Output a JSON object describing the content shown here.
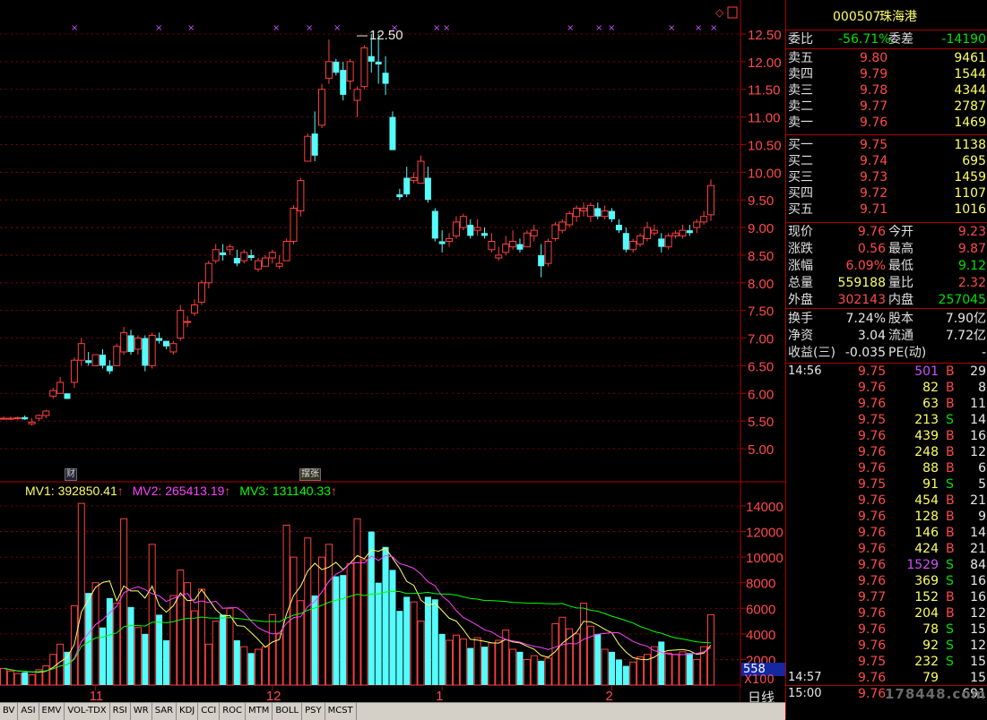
{
  "stock": {
    "code": "000507",
    "name": "珠海港"
  },
  "price_axis": [
    "12.50",
    "12.00",
    "11.50",
    "11.00",
    "10.50",
    "10.00",
    "9.50",
    "9.00",
    "8.50",
    "8.00",
    "7.50",
    "7.00",
    "6.50",
    "6.00",
    "5.50",
    "5.00"
  ],
  "volume_axis": [
    "14000",
    "12000",
    "10000",
    "8000",
    "6000",
    "4000",
    "2000"
  ],
  "volume_unit": "X100",
  "current_volume_badge": "558",
  "period_label": "日线",
  "nav_buttons": [
    "+",
    "-",
    "□"
  ],
  "month_labels": [
    "11",
    "12",
    "1",
    "2"
  ],
  "high_marker": "12.50",
  "event_tags": [
    "财",
    "摆张"
  ],
  "mv": {
    "mv1_label": "MV1: 392850.41",
    "mv2_label": "MV2: 265413.19",
    "mv3_label": "MV3: 131140.33",
    "colors": {
      "mv1": "#ffff66",
      "mv2": "#ff40ff",
      "mv3": "#00ff00"
    }
  },
  "indicator_tabs": [
    "BV",
    "ASI",
    "EMV",
    "VOL-TDX",
    "RSI",
    "WR",
    "SAR",
    "KDJ",
    "CCI",
    "ROC",
    "MTM",
    "BOLL",
    "PSY",
    "MCST"
  ],
  "quote": {
    "weibi": {
      "label": "委比",
      "value": "-56.71%",
      "label2": "委差",
      "value2": "-14190"
    },
    "sells": [
      {
        "label": "卖五",
        "price": "9.80",
        "vol": "9461"
      },
      {
        "label": "卖四",
        "price": "9.79",
        "vol": "1544"
      },
      {
        "label": "卖三",
        "price": "9.78",
        "vol": "4344"
      },
      {
        "label": "卖二",
        "price": "9.77",
        "vol": "2787"
      },
      {
        "label": "卖一",
        "price": "9.76",
        "vol": "1469"
      }
    ],
    "buys": [
      {
        "label": "买一",
        "price": "9.75",
        "vol": "1138"
      },
      {
        "label": "买二",
        "price": "9.74",
        "vol": "695"
      },
      {
        "label": "买三",
        "price": "9.73",
        "vol": "1459"
      },
      {
        "label": "买四",
        "price": "9.72",
        "vol": "1107"
      },
      {
        "label": "买五",
        "price": "9.71",
        "vol": "1016"
      }
    ],
    "stats": [
      {
        "l1": "现价",
        "v1": "9.76",
        "l2": "今开",
        "v2": "9.23",
        "c1": "red",
        "c2": "red"
      },
      {
        "l1": "涨跌",
        "v1": "0.56",
        "l2": "最高",
        "v2": "9.87",
        "c1": "red",
        "c2": "red"
      },
      {
        "l1": "涨幅",
        "v1": "6.09%",
        "l2": "最低",
        "v2": "9.12",
        "c1": "red",
        "c2": "green"
      },
      {
        "l1": "总量",
        "v1": "559188",
        "l2": "量比",
        "v2": "2.32",
        "c1": "yellow",
        "c2": "red"
      },
      {
        "l1": "外盘",
        "v1": "302143",
        "l2": "内盘",
        "v2": "257045",
        "c1": "red",
        "c2": "green"
      }
    ],
    "fundamentals": [
      {
        "l1": "换手",
        "v1": "7.24%",
        "l2": "股本",
        "v2": "7.90亿"
      },
      {
        "l1": "净资",
        "v1": "3.04",
        "l2": "流通",
        "v2": "7.72亿"
      },
      {
        "l1": "收益(三)",
        "v1": "-0.035",
        "l2": "PE(动)",
        "v2": "-"
      }
    ]
  },
  "ticks": [
    {
      "time": "14:56",
      "price": "9.75",
      "vol": "501",
      "bs": "B",
      "n": "29",
      "vc": "purple"
    },
    {
      "time": "",
      "price": "9.76",
      "vol": "82",
      "bs": "B",
      "n": "8",
      "vc": "yellow"
    },
    {
      "time": "",
      "price": "9.76",
      "vol": "63",
      "bs": "B",
      "n": "11",
      "vc": "yellow"
    },
    {
      "time": "",
      "price": "9.75",
      "vol": "213",
      "bs": "S",
      "n": "14",
      "vc": "yellow"
    },
    {
      "time": "",
      "price": "9.76",
      "vol": "439",
      "bs": "B",
      "n": "16",
      "vc": "yellow"
    },
    {
      "time": "",
      "price": "9.76",
      "vol": "248",
      "bs": "B",
      "n": "12",
      "vc": "yellow"
    },
    {
      "time": "",
      "price": "9.76",
      "vol": "88",
      "bs": "B",
      "n": "6",
      "vc": "yellow"
    },
    {
      "time": "",
      "price": "9.75",
      "vol": "91",
      "bs": "S",
      "n": "5",
      "vc": "yellow"
    },
    {
      "time": "",
      "price": "9.76",
      "vol": "454",
      "bs": "B",
      "n": "21",
      "vc": "yellow"
    },
    {
      "time": "",
      "price": "9.76",
      "vol": "128",
      "bs": "B",
      "n": "9",
      "vc": "yellow"
    },
    {
      "time": "",
      "price": "9.76",
      "vol": "146",
      "bs": "B",
      "n": "14",
      "vc": "yellow"
    },
    {
      "time": "",
      "price": "9.76",
      "vol": "424",
      "bs": "B",
      "n": "21",
      "vc": "yellow"
    },
    {
      "time": "",
      "price": "9.76",
      "vol": "1529",
      "bs": "S",
      "n": "84",
      "vc": "purple"
    },
    {
      "time": "",
      "price": "9.76",
      "vol": "369",
      "bs": "S",
      "n": "16",
      "vc": "yellow"
    },
    {
      "time": "",
      "price": "9.77",
      "vol": "152",
      "bs": "B",
      "n": "16",
      "vc": "yellow"
    },
    {
      "time": "",
      "price": "9.76",
      "vol": "204",
      "bs": "B",
      "n": "12",
      "vc": "yellow"
    },
    {
      "time": "",
      "price": "9.76",
      "vol": "78",
      "bs": "S",
      "n": "15",
      "vc": "yellow"
    },
    {
      "time": "",
      "price": "9.76",
      "vol": "92",
      "bs": "S",
      "n": "12",
      "vc": "yellow"
    },
    {
      "time": "",
      "price": "9.75",
      "vol": "232",
      "bs": "S",
      "n": "15",
      "vc": "yellow"
    },
    {
      "time": "14:57",
      "price": "9.76",
      "vol": "79",
      "bs": "",
      "n": "15",
      "vc": "yellow"
    },
    {
      "time": "15:00",
      "price": "9.76",
      "vol": "",
      "bs": "",
      "n": "691",
      "vc": "yellow"
    }
  ],
  "watermark": "178448.com",
  "chart_data": {
    "type": "candlestick",
    "price_ylim": [
      4.6,
      12.8
    ],
    "volume_ylim": [
      0,
      15000
    ],
    "candles": [
      [
        5.55,
        5.58,
        5.52,
        5.55
      ],
      [
        5.55,
        5.58,
        5.52,
        5.55
      ],
      [
        5.55,
        5.58,
        5.52,
        5.56
      ],
      [
        5.57,
        5.6,
        5.52,
        5.53
      ],
      [
        5.45,
        5.55,
        5.42,
        5.48
      ],
      [
        5.55,
        5.62,
        5.5,
        5.6
      ],
      [
        5.6,
        5.7,
        5.55,
        5.68
      ],
      [
        5.95,
        6.1,
        5.9,
        6.05
      ],
      [
        6.0,
        6.3,
        6.0,
        6.2
      ],
      [
        6.0,
        6.0,
        5.9,
        5.9
      ],
      [
        6.2,
        6.65,
        6.1,
        6.6
      ],
      [
        6.6,
        7.0,
        6.5,
        6.9
      ],
      [
        6.6,
        6.75,
        6.5,
        6.55
      ],
      [
        6.5,
        6.7,
        6.5,
        6.7
      ],
      [
        6.7,
        6.8,
        6.45,
        6.5
      ],
      [
        6.5,
        6.6,
        6.35,
        6.4
      ],
      [
        6.5,
        6.9,
        6.5,
        6.85
      ],
      [
        6.75,
        7.2,
        6.7,
        7.1
      ],
      [
        7.05,
        7.15,
        6.7,
        6.75
      ],
      [
        6.8,
        7.05,
        6.7,
        7.0
      ],
      [
        7.0,
        7.05,
        6.4,
        6.5
      ],
      [
        6.5,
        7.1,
        6.45,
        7.05
      ],
      [
        7.0,
        7.1,
        6.9,
        6.95
      ],
      [
        6.95,
        6.95,
        6.8,
        6.85
      ],
      [
        6.75,
        6.95,
        6.7,
        6.9
      ],
      [
        7.0,
        7.6,
        6.95,
        7.5
      ],
      [
        7.3,
        7.4,
        7.2,
        7.3
      ],
      [
        7.45,
        7.7,
        7.4,
        7.6
      ],
      [
        7.65,
        8.05,
        7.6,
        8.0
      ],
      [
        8.0,
        8.4,
        7.9,
        8.35
      ],
      [
        8.4,
        8.7,
        8.35,
        8.6
      ],
      [
        8.55,
        8.7,
        8.4,
        8.5
      ],
      [
        8.6,
        8.7,
        8.5,
        8.65
      ],
      [
        8.45,
        8.6,
        8.3,
        8.35
      ],
      [
        8.4,
        8.6,
        8.35,
        8.55
      ],
      [
        8.5,
        8.6,
        8.4,
        8.45
      ],
      [
        8.25,
        8.45,
        8.2,
        8.4
      ],
      [
        8.3,
        8.5,
        8.3,
        8.45
      ],
      [
        8.45,
        8.6,
        8.35,
        8.55
      ],
      [
        8.3,
        8.5,
        8.25,
        8.35
      ],
      [
        8.4,
        8.8,
        8.4,
        8.75
      ],
      [
        8.75,
        9.4,
        8.7,
        9.35
      ],
      [
        9.3,
        9.9,
        9.2,
        9.85
      ],
      [
        10.2,
        10.7,
        10.2,
        10.65
      ],
      [
        10.7,
        11.1,
        10.2,
        10.3
      ],
      [
        10.85,
        11.6,
        10.8,
        11.5
      ],
      [
        11.7,
        12.4,
        11.6,
        12.0
      ],
      [
        12.0,
        12.05,
        11.75,
        11.8
      ],
      [
        11.85,
        12.0,
        11.3,
        11.4
      ],
      [
        11.65,
        12.05,
        11.5,
        12.0
      ],
      [
        11.3,
        11.55,
        11.0,
        11.5
      ],
      [
        11.55,
        12.3,
        11.5,
        12.25
      ],
      [
        12.1,
        12.5,
        11.8,
        12.0
      ],
      [
        12.0,
        12.5,
        11.6,
        11.95
      ],
      [
        11.8,
        12.1,
        11.4,
        11.6
      ],
      [
        11.0,
        11.1,
        10.5,
        10.4
      ],
      [
        9.6,
        9.7,
        9.5,
        9.55
      ],
      [
        9.9,
        10.1,
        9.55,
        9.6
      ],
      [
        9.85,
        10.0,
        9.8,
        9.9
      ],
      [
        9.8,
        10.3,
        9.8,
        10.2
      ],
      [
        9.9,
        10.1,
        9.45,
        9.5
      ],
      [
        9.3,
        9.35,
        8.75,
        8.8
      ],
      [
        8.75,
        8.95,
        8.55,
        8.7
      ],
      [
        8.75,
        8.9,
        8.65,
        8.8
      ],
      [
        8.85,
        9.2,
        8.8,
        9.1
      ],
      [
        9.0,
        9.25,
        8.95,
        9.2
      ],
      [
        9.05,
        9.15,
        8.8,
        8.85
      ],
      [
        8.95,
        9.15,
        8.85,
        9.0
      ],
      [
        8.9,
        9.0,
        8.8,
        8.85
      ],
      [
        8.6,
        8.9,
        8.55,
        8.75
      ],
      [
        8.45,
        8.65,
        8.4,
        8.5
      ],
      [
        8.55,
        8.85,
        8.5,
        8.7
      ],
      [
        8.65,
        8.95,
        8.6,
        8.75
      ],
      [
        8.7,
        8.8,
        8.55,
        8.6
      ],
      [
        8.65,
        8.95,
        8.65,
        8.9
      ],
      [
        8.85,
        9.05,
        8.75,
        8.95
      ],
      [
        8.5,
        8.7,
        8.1,
        8.3
      ],
      [
        8.35,
        8.8,
        8.3,
        8.75
      ],
      [
        8.8,
        9.1,
        8.75,
        9.05
      ],
      [
        8.95,
        9.15,
        8.9,
        9.1
      ],
      [
        9.05,
        9.3,
        9.0,
        9.25
      ],
      [
        9.2,
        9.4,
        9.1,
        9.35
      ],
      [
        9.3,
        9.45,
        9.2,
        9.35
      ],
      [
        9.2,
        9.45,
        9.1,
        9.4
      ],
      [
        9.35,
        9.45,
        9.15,
        9.2
      ],
      [
        9.2,
        9.4,
        9.15,
        9.3
      ],
      [
        9.3,
        9.35,
        9.1,
        9.15
      ],
      [
        9.05,
        9.15,
        8.9,
        8.95
      ],
      [
        8.9,
        9.0,
        8.55,
        8.6
      ],
      [
        8.6,
        8.8,
        8.55,
        8.75
      ],
      [
        8.7,
        8.9,
        8.65,
        8.85
      ],
      [
        8.8,
        9.1,
        8.75,
        9.0
      ],
      [
        8.9,
        9.05,
        8.85,
        8.95
      ],
      [
        8.8,
        8.9,
        8.55,
        8.65
      ],
      [
        8.65,
        8.9,
        8.6,
        8.85
      ],
      [
        8.85,
        8.95,
        8.8,
        8.9
      ],
      [
        8.85,
        9.05,
        8.8,
        8.95
      ],
      [
        8.95,
        9.05,
        8.85,
        8.9
      ],
      [
        9.0,
        9.15,
        8.9,
        9.1
      ],
      [
        9.1,
        9.3,
        9.05,
        9.2
      ],
      [
        9.23,
        9.87,
        9.12,
        9.76
      ]
    ],
    "volumes": [
      1300,
      1100,
      900,
      1000,
      800,
      1200,
      1500,
      2400,
      3200,
      2600,
      6200,
      14200,
      7200,
      8000,
      4500,
      6800,
      6400,
      13000,
      6100,
      4500,
      4000,
      11000,
      5500,
      3500,
      7000,
      9000,
      8000,
      5800,
      7500,
      3200,
      5000,
      5500,
      6000,
      3500,
      3000,
      2500,
      2800,
      3000,
      5500,
      4000,
      12500,
      10000,
      6600,
      11500,
      7000,
      10000,
      11000,
      8500,
      8600,
      9500,
      13000,
      9800,
      12000,
      8000,
      10800,
      9000,
      5800,
      6900,
      6500,
      5000,
      6900,
      6700,
      4000,
      3500,
      3900,
      3600,
      2900,
      3700,
      3000,
      3300,
      3500,
      4300,
      2800,
      2600,
      2000,
      2300,
      1900,
      2100,
      4800,
      5300,
      4400,
      4000,
      6400,
      4600,
      4000,
      2800,
      2600,
      2000,
      1500,
      1800,
      2200,
      2400,
      3000,
      3400,
      2500,
      2400,
      2600,
      2500,
      2000,
      3000,
      5500
    ]
  }
}
